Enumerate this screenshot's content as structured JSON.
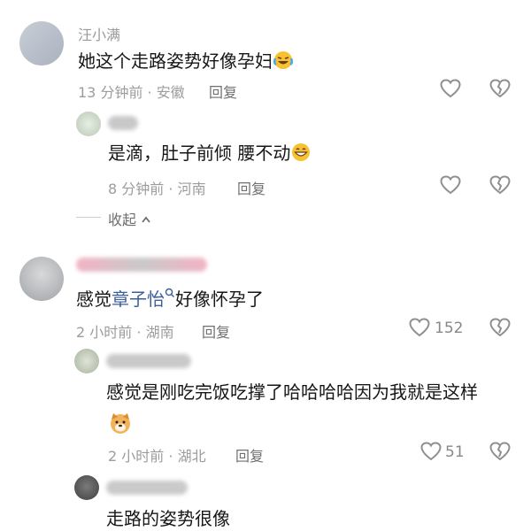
{
  "comments": [
    {
      "name": "汪小满",
      "text": "她这个走路姿势好像孕妇",
      "time": "13 分钟前",
      "location": "安徽",
      "reply_label": "回复"
    },
    {
      "text": "是滴，肚子前倾 腰不动",
      "time": "8 分钟前",
      "location": "河南",
      "reply_label": "回复"
    },
    {
      "collapse_label": "收起"
    },
    {
      "text_prefix": "感觉",
      "mention": "章子怡",
      "text_suffix": "好像怀孕了",
      "time": "2 小时前",
      "location": "湖南",
      "reply_label": "回复",
      "likes": "152"
    },
    {
      "text": "感觉是刚吃完饭吃撑了哈哈哈哈因为我就是这样",
      "time": "2 小时前",
      "location": "湖北",
      "reply_label": "回复",
      "likes": "51"
    },
    {
      "text": "走路的姿势很像"
    }
  ],
  "separator": "·"
}
